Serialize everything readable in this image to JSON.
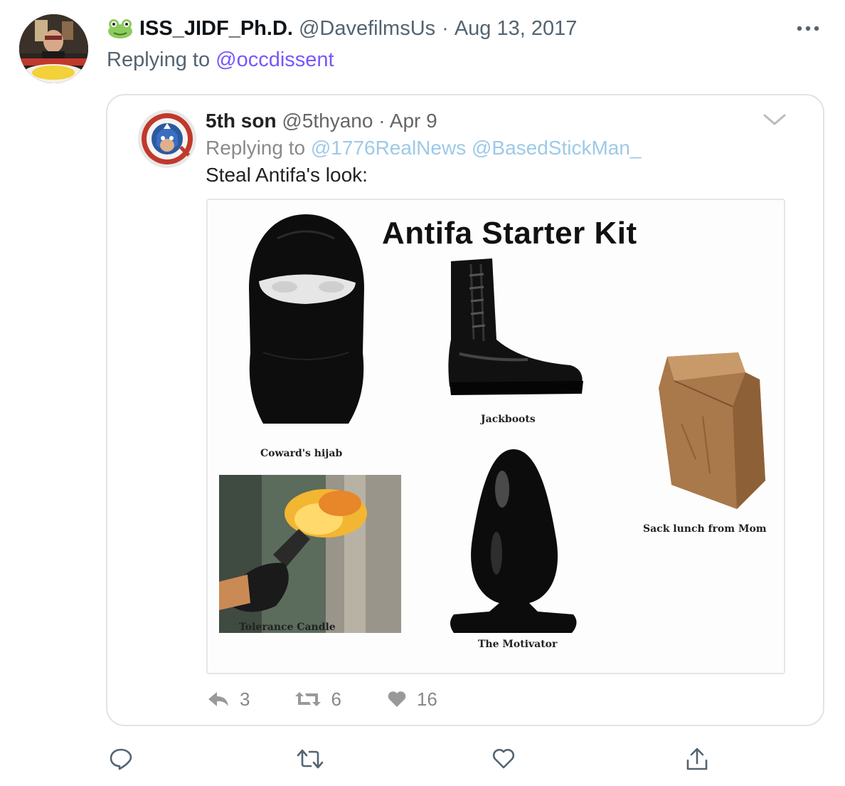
{
  "tweet": {
    "display_name": "ISS_JIDF_Ph.D.",
    "handle": "@DavefilmsUs",
    "separator": "·",
    "date": "Aug 13, 2017",
    "replying_prefix": "Replying to",
    "replying_to": "@occdissent",
    "name_emoji": "frog-face-icon"
  },
  "quoted_tweet": {
    "display_name": "5th son",
    "handle": "@5thyano",
    "separator": "·",
    "date": "Apr 9",
    "replying_prefix": "Replying to",
    "replying_to": [
      "@1776RealNews",
      "@BasedStickMan_"
    ],
    "text": "Steal Antifa's look:",
    "image": {
      "title": "Antifa Starter Kit",
      "captions": {
        "mask": "Coward's hijab",
        "boots": "Jackboots",
        "bag": "Sack lunch from Mom",
        "fire": "Tolerance Candle",
        "plug": "The Motivator"
      }
    },
    "stats": {
      "replies": "3",
      "retweets": "6",
      "likes": "16"
    }
  },
  "actions": [
    "reply-icon",
    "retweet-icon",
    "like-icon",
    "share-icon"
  ],
  "colors": {
    "accent": "#7856ff",
    "secondary_text": "#536471",
    "border": "#dfe3e8"
  }
}
